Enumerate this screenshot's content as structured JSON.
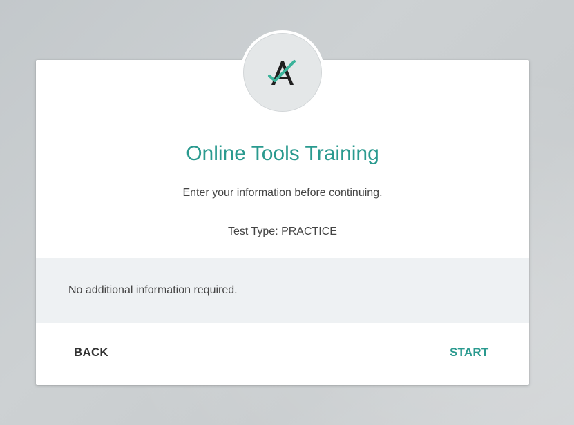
{
  "dialog": {
    "title": "Online Tools Training",
    "subtitle": "Enter your information before continuing.",
    "test_type": "Test Type: PRACTICE",
    "info_message": "No additional information required.",
    "back_label": "BACK",
    "start_label": "START"
  },
  "logo": {
    "icon": "a-checkmark-logo-icon"
  },
  "colors": {
    "accent": "#2a9a8f",
    "check": "#3bb39a",
    "text": "#444444",
    "band": "#eef1f3"
  }
}
